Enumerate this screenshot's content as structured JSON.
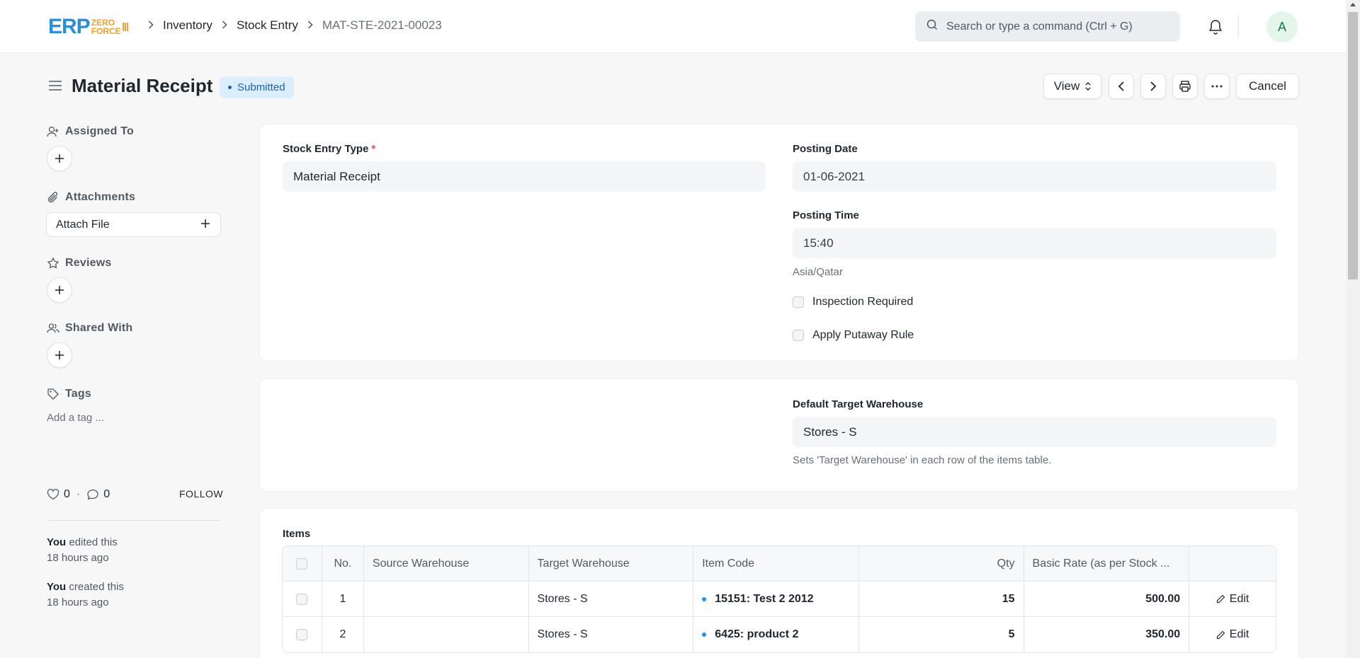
{
  "logo": {
    "main": "ERP",
    "top": "ZERO",
    "bottom": "FORCE"
  },
  "breadcrumb": {
    "items": [
      "Inventory",
      "Stock Entry"
    ],
    "current": "MAT-STE-2021-00023"
  },
  "search": {
    "placeholder": "Search or type a command (Ctrl + G)"
  },
  "user": {
    "avatar_initial": "A"
  },
  "page": {
    "title": "Material Receipt",
    "status": "Submitted"
  },
  "toolbar": {
    "view_label": "View",
    "cancel_label": "Cancel"
  },
  "sidebar": {
    "assigned_to": "Assigned To",
    "attachments": "Attachments",
    "attach_file": "Attach File",
    "reviews": "Reviews",
    "shared_with": "Shared With",
    "tags": "Tags",
    "add_tag": "Add a tag ...",
    "likes": "0",
    "comments": "0",
    "follow": "FOLLOW",
    "activity": [
      {
        "who": "You",
        "action": " edited this",
        "when": "18 hours ago"
      },
      {
        "who": "You",
        "action": " created this",
        "when": "18 hours ago"
      }
    ]
  },
  "form": {
    "stock_entry_type_label": "Stock Entry Type",
    "stock_entry_type": "Material Receipt",
    "posting_date_label": "Posting Date",
    "posting_date": "01-06-2021",
    "posting_time_label": "Posting Time",
    "posting_time": "15:40",
    "timezone": "Asia/Qatar",
    "inspection_required": "Inspection Required",
    "apply_putaway_rule": "Apply Putaway Rule",
    "default_target_warehouse_label": "Default Target Warehouse",
    "default_target_warehouse": "Stores - S",
    "default_target_help": "Sets 'Target Warehouse' in each row of the items table."
  },
  "items": {
    "title": "Items",
    "columns": [
      "No.",
      "Source Warehouse",
      "Target Warehouse",
      "Item Code",
      "Qty",
      "Basic Rate (as per Stock ..."
    ],
    "edit_label": "Edit",
    "rows": [
      {
        "no": "1",
        "source": "",
        "target": "Stores - S",
        "item_code": "15151: Test 2 2012",
        "qty": "15",
        "rate": "500.00"
      },
      {
        "no": "2",
        "source": "",
        "target": "Stores - S",
        "item_code": "6425: product 2",
        "qty": "5",
        "rate": "350.00"
      }
    ]
  },
  "colors": {
    "accent": "#2490ef",
    "badge_bg": "#dceefc",
    "badge_text": "#1366b3",
    "required": "#e24c4c"
  }
}
